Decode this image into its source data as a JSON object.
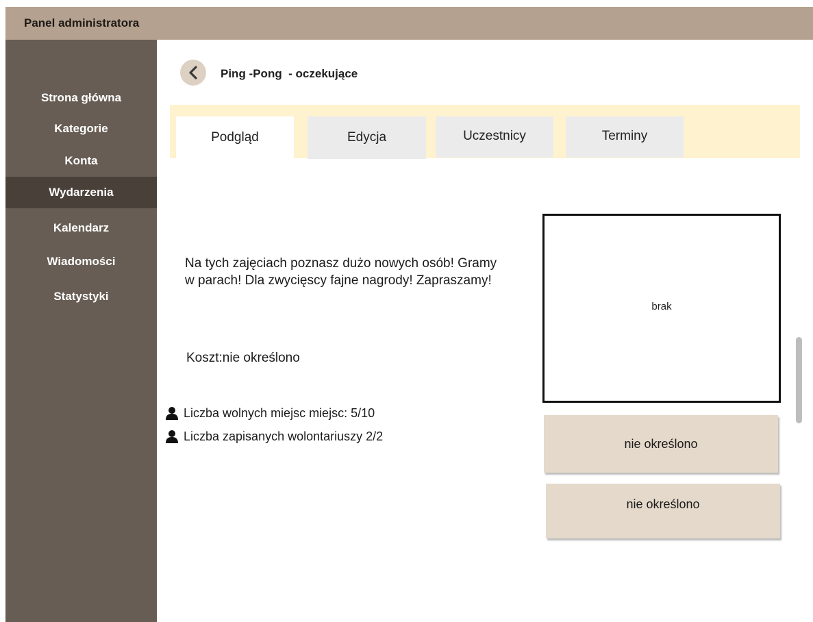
{
  "app": {
    "title": "Panel administratora"
  },
  "sidebar": {
    "items": [
      {
        "label": "Strona główna"
      },
      {
        "label": "Kategorie"
      },
      {
        "label": "Konta"
      },
      {
        "label": "Wydarzenia",
        "active": true
      },
      {
        "label": "Kalendarz"
      },
      {
        "label": "Wiadomości"
      },
      {
        "label": "Statystyki"
      }
    ]
  },
  "header": {
    "title": "Ping -Pong  - oczekujące"
  },
  "tabs": [
    {
      "label": "Podgląd",
      "active": true
    },
    {
      "label": "Edycja"
    },
    {
      "label": "Uczestnicy"
    },
    {
      "label": "Terminy"
    }
  ],
  "event": {
    "description": "Na tych zajęciach poznasz dużo nowych osób! Gramy w parach! Dla zwycięscy fajne nagrody! Zapraszamy!",
    "cost": "Koszt:nie określono",
    "free_places": "Liczba wolnych miejsc miejsc:  5/10",
    "volunteers": "Liczba zapisanych wolontariuszy 2/2",
    "image_placeholder": "brak",
    "info_1": "nie określono",
    "info_2": "nie określono"
  },
  "colors": {
    "topbar": "#b5a18f",
    "sidebar": "#675d54",
    "sidebar_active": "#4a403a",
    "tabstrip": "#fff2cf",
    "info_button": "#e4d9ca"
  },
  "icons": {
    "back": "chevron-left-icon",
    "person": "person-icon"
  }
}
